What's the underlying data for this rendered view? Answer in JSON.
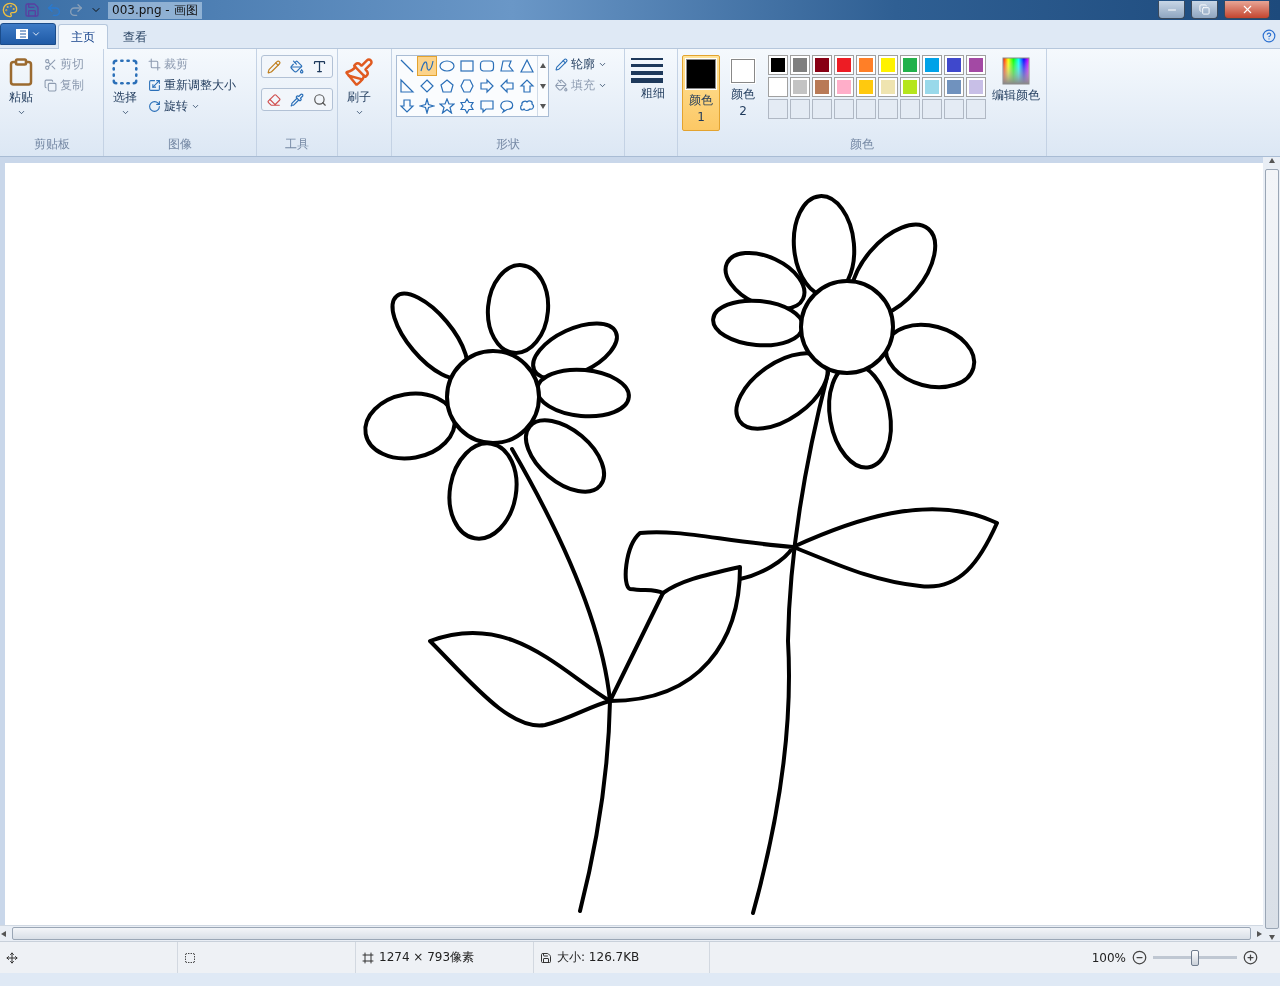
{
  "window": {
    "title": "003.png - 画图"
  },
  "tabs": [
    {
      "label": "主页",
      "selected": true
    },
    {
      "label": "查看",
      "selected": false
    }
  ],
  "clipboard": {
    "label": "剪贴板",
    "paste": "粘贴",
    "cut": {
      "label": "剪切",
      "disabled": true
    },
    "copy": {
      "label": "复制",
      "disabled": true
    }
  },
  "image": {
    "label": "图像",
    "select": "选择",
    "crop": {
      "label": "裁剪",
      "disabled": true
    },
    "resize": {
      "label": "重新调整大小",
      "disabled": false
    },
    "rotate": {
      "label": "旋转",
      "disabled": false
    }
  },
  "tools": {
    "label": "工具"
  },
  "brushes": {
    "label": "刷子"
  },
  "shapes": {
    "label": "形状",
    "outline": {
      "label": "轮廓",
      "disabled": false
    },
    "fill": {
      "label": "填充",
      "disabled": true
    },
    "items": [
      {
        "kind": "line",
        "selected": false
      },
      {
        "kind": "curve",
        "selected": true
      },
      {
        "kind": "oval",
        "selected": false
      },
      {
        "kind": "rect",
        "selected": false
      },
      {
        "kind": "roundrect",
        "selected": false
      },
      {
        "kind": "polygon",
        "selected": false
      },
      {
        "kind": "triangle",
        "selected": false
      },
      {
        "kind": "right-triangle",
        "selected": false
      },
      {
        "kind": "diamond",
        "selected": false
      },
      {
        "kind": "pentagon",
        "selected": false
      },
      {
        "kind": "hexagon",
        "selected": false
      },
      {
        "kind": "arrow-right",
        "selected": false
      },
      {
        "kind": "arrow-left",
        "selected": false
      },
      {
        "kind": "arrow-up",
        "selected": false
      },
      {
        "kind": "arrow-down",
        "selected": false
      },
      {
        "kind": "star4",
        "selected": false
      },
      {
        "kind": "star5",
        "selected": false
      },
      {
        "kind": "star6",
        "selected": false
      },
      {
        "kind": "callout-rect",
        "selected": false
      },
      {
        "kind": "callout-oval",
        "selected": false
      },
      {
        "kind": "callout-cloud",
        "selected": false
      }
    ]
  },
  "size": {
    "label": "粗细"
  },
  "colors": {
    "label": "颜色",
    "current": [
      {
        "label": "颜色 1",
        "color": "#000000",
        "selected": true
      },
      {
        "label": "颜色 2",
        "color": "#ffffff",
        "selected": false
      }
    ],
    "palette": [
      {
        "color": "#000000"
      },
      {
        "color": "#7f7f7f"
      },
      {
        "color": "#880015"
      },
      {
        "color": "#ed1c24"
      },
      {
        "color": "#ff7f27"
      },
      {
        "color": "#fff200"
      },
      {
        "color": "#22b14c"
      },
      {
        "color": "#00a2e8"
      },
      {
        "color": "#3f48cc"
      },
      {
        "color": "#a349a4"
      },
      {
        "color": "#ffffff"
      },
      {
        "color": "#c3c3c3"
      },
      {
        "color": "#b97a57"
      },
      {
        "color": "#ffaec9"
      },
      {
        "color": "#ffc90e"
      },
      {
        "color": "#efe4b0"
      },
      {
        "color": "#b5e61d"
      },
      {
        "color": "#99d9ea"
      },
      {
        "color": "#7092be"
      },
      {
        "color": "#c8bfe7"
      }
    ],
    "edit": "编辑颜色"
  },
  "status_bar": {
    "dimensions": "1274 × 793像素",
    "file_size": "大小: 126.7KB",
    "zoom": "100%",
    "zoom_level": {
      "level": 0.5
    }
  }
}
